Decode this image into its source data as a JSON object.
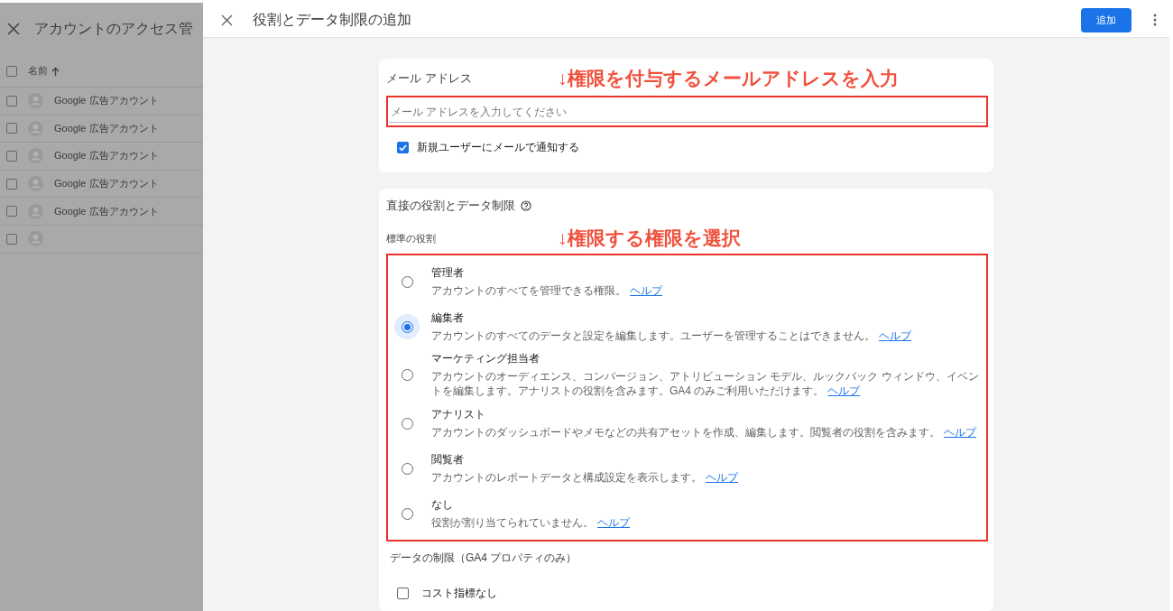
{
  "background_panel": {
    "title": "アカウントのアクセス管",
    "header_checkbox": {
      "checked": false
    },
    "name_column": "名前",
    "rows": [
      {
        "kind": "account",
        "name": "Google 広告アカウント",
        "checked": false
      },
      {
        "kind": "account",
        "name": "Google 広告アカウント",
        "checked": false
      },
      {
        "kind": "account",
        "name": "Google 広告アカウント",
        "checked": false
      },
      {
        "kind": "account",
        "name": "Google 広告アカウント",
        "checked": false
      },
      {
        "kind": "account",
        "name": "Google 広告アカウント",
        "checked": false
      },
      {
        "kind": "blank",
        "checked": false
      }
    ]
  },
  "dialog": {
    "title": "役割とデータ制限の追加",
    "add_button": "追加",
    "email_card": {
      "title": "メール アドレス",
      "annotation": "↓権限を付与するメールアドレスを入力",
      "placeholder": "メール アドレスを入力してください",
      "notify": {
        "label": "新規ユーザーにメールで通知する",
        "checked": true
      }
    },
    "roles_card": {
      "title": "直接の役割とデータ制限",
      "subtitle": "標準の役割",
      "annotation": "↓権限する権限を選択",
      "roles": [
        {
          "title": "管理者",
          "description": "アカウントのすべてを管理できる権限。",
          "link": "ヘルプ",
          "selected": false
        },
        {
          "title": "編集者",
          "description": "アカウントのすべてのデータと設定を編集します。ユーザーを管理することはできません。",
          "link": "ヘルプ",
          "selected": true
        },
        {
          "title": "マーケティング担当者",
          "description": "アカウントのオーディエンス、コンバージョン、アトリビューション モデル、ルックバック ウィンドウ、イベントを編集します。アナリストの役割を含みます。GA4 のみご利用いただけます。",
          "link": "ヘルプ",
          "selected": false
        },
        {
          "title": "アナリスト",
          "description": "アカウントのダッシュボードやメモなどの共有アセットを作成、編集します。閲覧者の役割を含みます。",
          "link": "ヘルプ",
          "selected": false
        },
        {
          "title": "閲覧者",
          "description": "アカウントのレポートデータと構成設定を表示します。",
          "link": "ヘルプ",
          "selected": false
        },
        {
          "title": "なし",
          "description": "役割が割り当てられていません。",
          "link": "ヘルプ",
          "selected": false
        }
      ],
      "restrictions_title": "データの制限（GA4 プロパティのみ）",
      "restrictions": [
        {
          "title": "コスト指標なし",
          "checked": false
        }
      ]
    }
  }
}
